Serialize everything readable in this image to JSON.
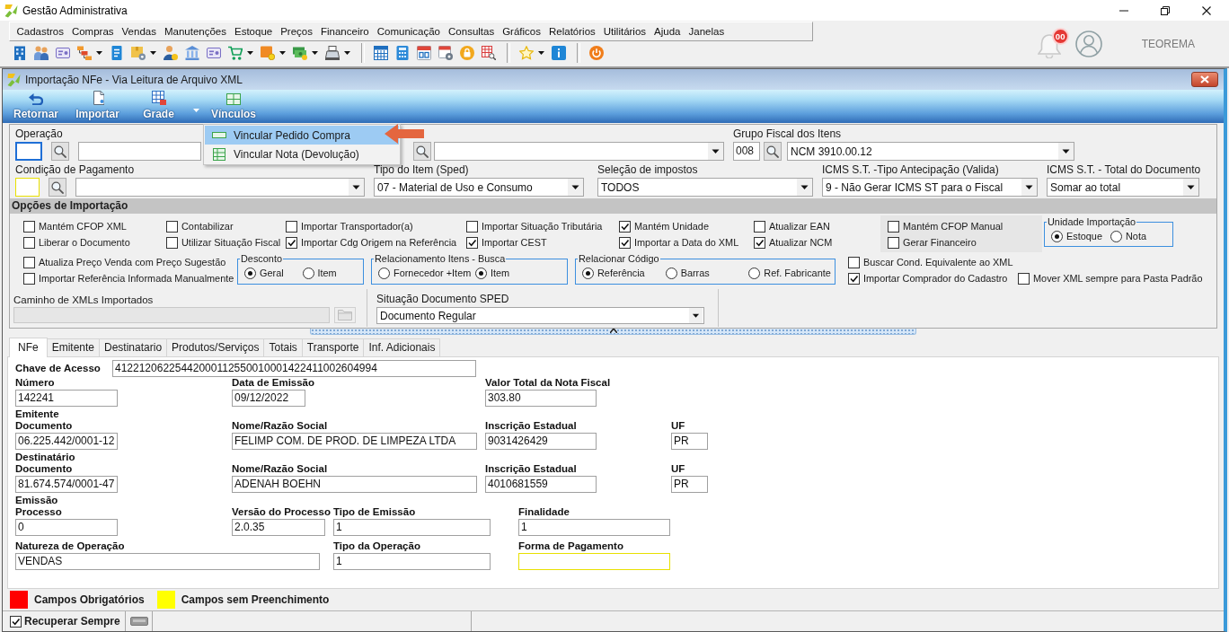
{
  "app": {
    "title": "Gestão Administrativa"
  },
  "menu": [
    "Cadastros",
    "Compras",
    "Vendas",
    "Manutenções",
    "Estoque",
    "Preços",
    "Financeiro",
    "Comunicação",
    "Consultas",
    "Gráficos",
    "Relatórios",
    "Utilitários",
    "Ajuda",
    "Janelas"
  ],
  "toolbar": {
    "groups": [
      [
        {
          "dropdown": false
        },
        {
          "dropdown": false
        },
        {
          "dropdown": false
        },
        {
          "dropdown": true
        },
        {
          "dropdown": false
        },
        {
          "dropdown": true
        },
        {
          "dropdown": false
        },
        {
          "dropdown": false
        },
        {
          "dropdown": false
        },
        {
          "dropdown": true
        },
        {
          "dropdown": true
        },
        {
          "dropdown": true
        },
        {
          "dropdown": true
        }
      ],
      [
        {
          "dropdown": false
        },
        {
          "dropdown": false
        },
        {
          "dropdown": false
        },
        {
          "dropdown": false
        },
        {
          "dropdown": false
        },
        {
          "dropdown": false
        }
      ],
      [
        {
          "dropdown": true
        },
        {
          "dropdown": false
        }
      ],
      [
        {
          "dropdown": false
        }
      ]
    ]
  },
  "notifications": {
    "count": "00"
  },
  "user": {
    "name": "TEOREMA"
  },
  "window": {
    "title": "Importação NFe - Via Leitura de Arquivo XML"
  },
  "ribbon": {
    "buttons": [
      {
        "label": "Retornar",
        "dropdown": false
      },
      {
        "label": "Importar",
        "dropdown": false
      },
      {
        "label": "Grade",
        "dropdown": true
      },
      {
        "label": "Vínculos",
        "dropdown": false
      }
    ],
    "menu": [
      {
        "label": "Vincular Pedido Compra",
        "selected": true
      },
      {
        "label": "Vincular Nota (Devolução)",
        "selected": false
      }
    ]
  },
  "header": {
    "rows": [
      [
        {
          "kind": "lookup",
          "label": "Operação",
          "focused": true,
          "unfilled": false,
          "dropdown": false
        },
        {
          "kind": "search_select"
        },
        {
          "kind": "lookup",
          "label": "Grupo Fiscal dos Itens",
          "code": "008",
          "focused": false,
          "unfilled": false,
          "dropdown": true,
          "value": "NCM 3910.00.12"
        }
      ],
      [
        {
          "kind": "lookup",
          "label": "Condição de Pagamento",
          "focused": false,
          "unfilled": true,
          "dropdown": true
        },
        {
          "kind": "select",
          "label": "Tipo do Item (Sped)",
          "value": "07 - Material de Uso e Consumo"
        },
        {
          "kind": "select",
          "label": "Seleção de impostos",
          "value": "TODOS"
        },
        {
          "kind": "select",
          "label": "ICMS S.T. -Tipo Antecipação (Valida)",
          "value": "9 - Não Gerar ICMS ST para o Fiscal"
        },
        {
          "kind": "select",
          "label": "ICMS S.T. - Total do Documento",
          "value": "Somar ao total"
        }
      ]
    ]
  },
  "options": {
    "title": "Opções de Importação",
    "checks": [
      {
        "label": "Mantém CFOP XML",
        "checked": false
      },
      {
        "label": "Contabilizar",
        "checked": false
      },
      {
        "label": "Importar Transportador(a)",
        "checked": false
      },
      {
        "label": "Importar Situação Tributária",
        "checked": false
      },
      {
        "label": "Mantém Unidade",
        "checked": true
      },
      {
        "label": "Atualizar EAN",
        "checked": false
      },
      {
        "label": "Liberar o Documento",
        "checked": false
      },
      {
        "label": "Utilizar Situação Fiscal",
        "checked": false
      },
      {
        "label": "Importar Cdg Origem na Referência",
        "checked": true
      },
      {
        "label": "Importar CEST",
        "checked": true
      },
      {
        "label": "Importar a Data do XML",
        "checked": true
      },
      {
        "label": "Atualizar NCM",
        "checked": true
      }
    ],
    "panel_checks": [
      {
        "label": "Mantém CFOP Manual",
        "checked": false
      },
      {
        "label": "Gerar Financeiro",
        "checked": false
      }
    ],
    "unit_group": {
      "title": "Unidade Importação",
      "options": [
        {
          "label": "Estoque",
          "selected": true
        },
        {
          "label": "Nota",
          "selected": false
        }
      ]
    },
    "left_checks": [
      {
        "label": "Atualiza Preço Venda com Preço Sugestão",
        "checked": false
      },
      {
        "label": "Importar Referência Informada Manualmente",
        "checked": false
      }
    ],
    "radio_groups": [
      {
        "title": "Desconto",
        "options": [
          {
            "label": "Geral",
            "selected": true
          },
          {
            "label": "Item",
            "selected": false
          }
        ]
      },
      {
        "title": "Relacionamento Itens - Busca",
        "options": [
          {
            "label": "Fornecedor +Item",
            "selected": false
          },
          {
            "label": "Item",
            "selected": true
          }
        ]
      },
      {
        "title": "Relacionar Código",
        "options": [
          {
            "label": "Referência",
            "selected": true
          },
          {
            "label": "Barras",
            "selected": false
          },
          {
            "label": "Ref. Fabricante",
            "selected": false
          }
        ]
      }
    ],
    "right_checks": [
      {
        "label": "Buscar Cond. Equivalente ao XML",
        "checked": false
      },
      {
        "label": "Importar Comprador do Cadastro",
        "checked": true
      },
      {
        "label": "Mover XML sempre para Pasta Padrão",
        "checked": false
      }
    ]
  },
  "xml_path": {
    "label": "Caminho de XMLs Importados",
    "disabled": true
  },
  "sped_situation": {
    "label": "Situação Documento SPED",
    "value": "Documento Regular"
  },
  "tabs": [
    {
      "label": "NFe",
      "selected": true
    },
    {
      "label": "Emitente",
      "selected": false
    },
    {
      "label": "Destinatario",
      "selected": false
    },
    {
      "label": "Produtos/Serviços",
      "selected": false
    },
    {
      "label": "Totais",
      "selected": false
    },
    {
      "label": "Transporte",
      "selected": false
    },
    {
      "label": "Inf. Adicionais",
      "selected": false
    }
  ],
  "nfe": {
    "access_key": {
      "label": "Chave de Acesso",
      "value": "41221206225442000112550010001422411002604994"
    },
    "rows": [
      {
        "fields": [
          {
            "label": "Número",
            "value": "142241",
            "unfilled": false
          },
          {
            "label": "Data de Emissão",
            "value": "09/12/2022",
            "unfilled": false
          },
          {
            "label": "Valor Total da Nota Fiscal",
            "value": "303.80",
            "unfilled": false
          }
        ]
      },
      {
        "group": "Emitente",
        "fields": [
          {
            "label": "Documento",
            "value": "06.225.442/0001-12",
            "unfilled": false
          },
          {
            "label": "Nome/Razão Social",
            "value": "FELIMP COM. DE PROD. DE LIMPEZA LTDA",
            "unfilled": false
          },
          {
            "label": "Inscrição Estadual",
            "value": "9031426429",
            "unfilled": false
          },
          {
            "label": "UF",
            "value": "PR",
            "unfilled": false
          }
        ]
      },
      {
        "group": "Destinatário",
        "fields": [
          {
            "label": "Documento",
            "value": "81.674.574/0001-47",
            "unfilled": false
          },
          {
            "label": "Nome/Razão Social",
            "value": "ADENAH BOEHN",
            "unfilled": false
          },
          {
            "label": "Inscrição Estadual",
            "value": "4010681559",
            "unfilled": false
          },
          {
            "label": "UF",
            "value": "PR",
            "unfilled": false
          }
        ]
      },
      {
        "group": "Emissão",
        "fields": [
          {
            "label": "Processo",
            "value": "0",
            "unfilled": false
          },
          {
            "label": "Versão do Processo",
            "value": "2.0.35",
            "unfilled": false
          },
          {
            "label": "Tipo de Emissão",
            "value": "1",
            "unfilled": false
          },
          {
            "label": "Finalidade",
            "value": "1",
            "unfilled": false
          }
        ]
      },
      {
        "fields": [
          {
            "label": "Natureza de Operação",
            "value": "VENDAS",
            "unfilled": false
          },
          {
            "label": "Tipo da Operação",
            "value": "1",
            "unfilled": false
          },
          {
            "label": "Forma de Pagamento",
            "unfilled": true
          }
        ]
      }
    ]
  },
  "legend": [
    {
      "label": "Campos Obrigatórios",
      "color": "#ff0000"
    },
    {
      "label": "Campos sem Preenchimento",
      "color": "#ffff00"
    }
  ],
  "status_bar": {
    "recover": {
      "label": "Recuperar Sempre",
      "checked": true
    }
  }
}
